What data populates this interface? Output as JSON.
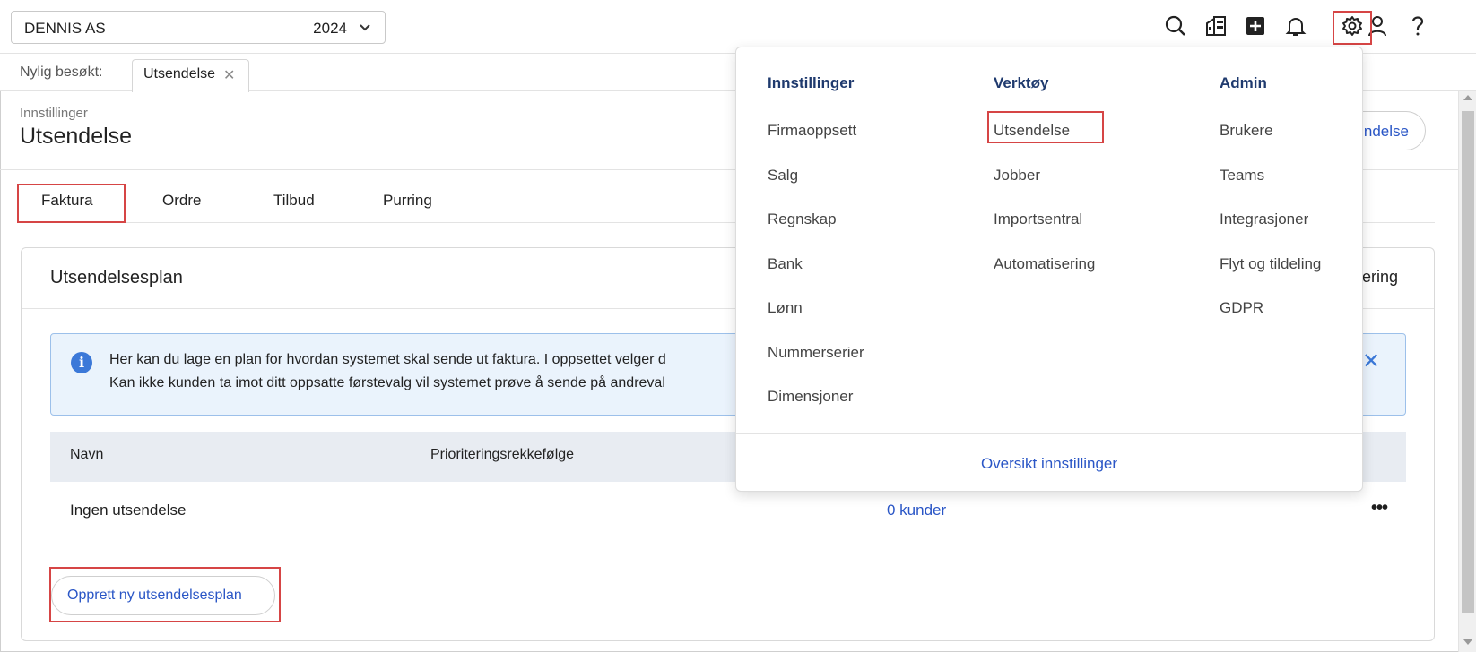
{
  "header": {
    "company": "DENNIS AS",
    "year": "2024",
    "icons": [
      "search-icon",
      "building-icon",
      "plus-square-icon",
      "bell-icon",
      "gear-icon",
      "user-icon",
      "help-icon"
    ]
  },
  "recent": {
    "label": "Nylig besøkt:",
    "tabs": [
      {
        "label": "Utsendelse"
      }
    ]
  },
  "page": {
    "breadcrumb": "Innstillinger",
    "title": "Utsendelse",
    "header_button": "ndelse"
  },
  "tabs": [
    {
      "label": "Faktura"
    },
    {
      "label": "Ordre"
    },
    {
      "label": "Tilbud"
    },
    {
      "label": "Purring"
    }
  ],
  "card": {
    "title": "Utsendelsesplan",
    "right_text": "rering",
    "info": {
      "line1": "Her kan du lage en plan for hvordan systemet skal sende ut faktura. I oppsettet velger d",
      "line2": "Kan ikke kunden ta imot ditt oppsatte førstevalg vil systemet prøve å sende på andreval"
    },
    "columns": [
      "Navn",
      "Prioriteringsrekkefølge"
    ],
    "rows": [
      {
        "name": "Ingen utsendelse",
        "customers": "0 kunder",
        "menu": "•••"
      }
    ],
    "new_button": "Opprett ny utsendelsesplan"
  },
  "dropdown": {
    "columns": [
      {
        "title": "Innstillinger",
        "items": [
          "Firmaoppsett",
          "Salg",
          "Regnskap",
          "Bank",
          "Lønn",
          "Nummerserier",
          "Dimensjoner"
        ]
      },
      {
        "title": "Verktøy",
        "items": [
          "Utsendelse",
          "Jobber",
          "Importsentral",
          "Automatisering"
        ]
      },
      {
        "title": "Admin",
        "items": [
          "Brukere",
          "Teams",
          "Integrasjoner",
          "Flyt og tildeling",
          "GDPR"
        ]
      }
    ],
    "footer": "Oversikt innstillinger"
  },
  "colors": {
    "accent": "#2a56c6",
    "highlight": "#d64545",
    "info_bg": "#eaf3fc"
  }
}
